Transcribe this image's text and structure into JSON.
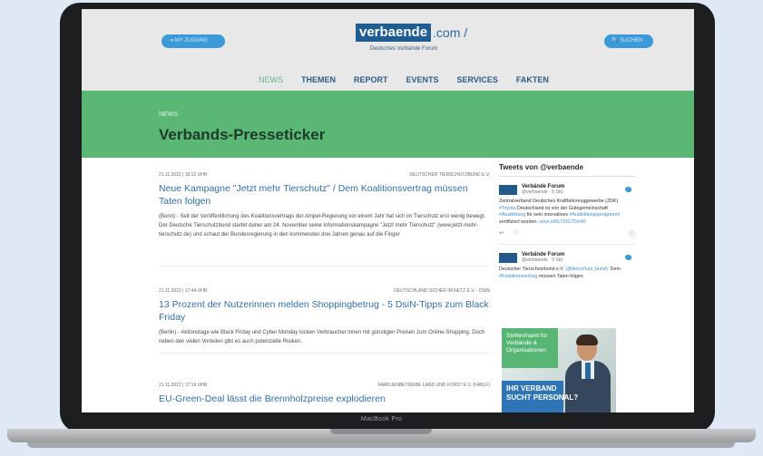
{
  "header": {
    "login_label": "⇥ MY ZUGANG",
    "search_label": "🔍 SUCHEN",
    "logo_box": "verbaende",
    "logo_tld": ".com /",
    "tagline": "Deutsches Verbände Forum"
  },
  "nav": {
    "items": [
      "NEWS",
      "THEMEN",
      "REPORT",
      "EVENTS",
      "SERVICES",
      "FAKTEN"
    ]
  },
  "banner": {
    "crumb": "NEWS",
    "title": "Verbands-Presseticker"
  },
  "articles": [
    {
      "date": "21.11.2022 | 18:12 UHR",
      "source": "DEUTSCHER TIERSCHUTZBUND E.V.",
      "title": "Neue Kampagne \"Jetzt mehr Tierschutz\" / Dem Koalitionsvertrag müssen Taten folgen",
      "teaser": "(Bonn) - Seit der Veröffentlichung des Koalitionsvertrags der Ampel-Regierung vor einem Jahr hat sich im Tierschutz erst wenig bewegt. Der Deutsche Tierschutzbund startet daher am 24. November seine Informationskampagne \"Jetzt mehr Tierschutz\" (www.jetzt-mehr-tierschutz.de) und schaut der Bundesregierung in den kommenden drei Jahren genau auf die Finger"
    },
    {
      "date": "21.11.2022 | 17:44 UHR",
      "source": "DEUTSCHLAND SICHER IM NETZ E.V. - DSIN",
      "title": "13 Prozent der Nutzerinnen melden Shoppingbetrug - 5 DsiN-Tipps zum Black Friday",
      "teaser": "(Berlin) - Aktionstage wie Black Friday und Cyber Monday locken Verbraucher:innen mit günstigen Preisen zum Online-Shopping. Doch neben den vielen Vorteilen gibt es auch potenzielle Risiken."
    },
    {
      "date": "21.11.2022 | 17:19 UHR",
      "source": "FAMILIENBETRIEBE LAND UND FORST E.V. (FABLF)",
      "title": "EU-Green-Deal lässt die Brennholzpreise explodieren",
      "teaser": ""
    }
  ],
  "tweets": {
    "heading": "Tweets von @verbaende",
    "items": [
      {
        "name": "Verbände Forum",
        "handle": "@verbaende · 8 Std.",
        "text_plain": "Zentralverband Deutsches Kraftfahrzeuggewerbe (ZDK) ",
        "link1": "#Toyota",
        "text_mid": " Deutschland ist von der Gütegemeinschaft ",
        "link2": "#Ausbildung",
        "text_mid2": " für sein innovatives ",
        "link3": "#Ausbildungsprogramm",
        "text_end": " zertifiziert worden. ",
        "link4": "zeus.it/BLT2IS7Cm40"
      },
      {
        "name": "Verbände Forum",
        "handle": "@verbaende · 9 Std.",
        "text_plain": "Deutscher Tierschutzbund e.V. ",
        "link1": "(@tierschutz_bund):",
        "text_mid": " Dem ",
        "link2": "#Koalitionsvertrag",
        "text_mid2": " müssen Taten folgen ",
        "link3": "",
        "text_end": "",
        "link4": ""
      }
    ]
  },
  "ad": {
    "line1": "Stellenmarkt für Verbände & Organisationen",
    "line2a": "IHR VERBAND",
    "line2b": "SUCHT PERSONAL?"
  },
  "device": {
    "model": "MacBook Pro"
  },
  "colors": {
    "accent_blue": "#3d9ad9",
    "banner_green": "#5ab874",
    "logo_blue": "#1f5d93",
    "nav_blue": "#2d5c87"
  }
}
